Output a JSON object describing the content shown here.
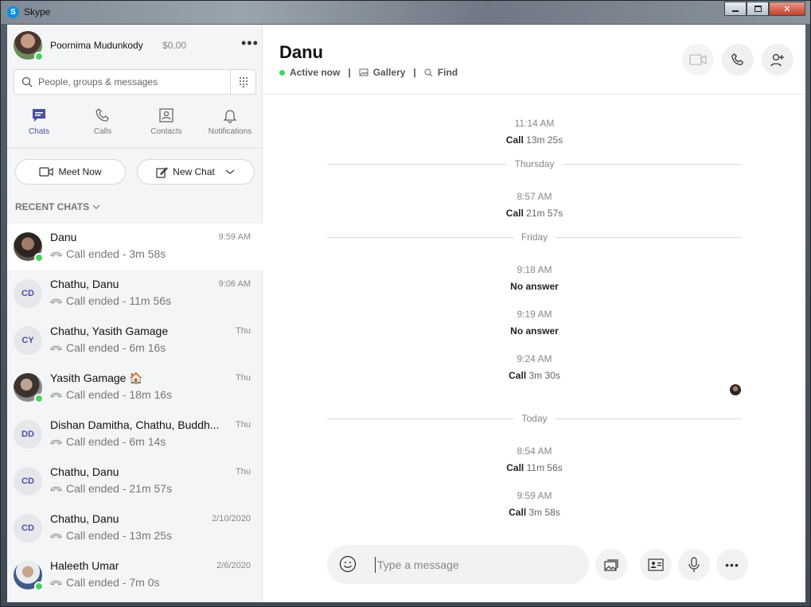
{
  "window": {
    "title": "Skype"
  },
  "profile": {
    "name": "Poornima Mudunkody",
    "credit": "$0.00"
  },
  "search": {
    "placeholder": "People, groups & messages"
  },
  "nav": [
    {
      "label": "Chats"
    },
    {
      "label": "Calls"
    },
    {
      "label": "Contacts"
    },
    {
      "label": "Notifications"
    }
  ],
  "actions": {
    "meet_now": "Meet Now",
    "new_chat": "New Chat"
  },
  "recent": {
    "title": "RECENT CHATS"
  },
  "chats": [
    {
      "name": "Danu",
      "time": "9:59 AM",
      "sub": "Call ended - 3m 58s",
      "initials": ""
    },
    {
      "name": "Chathu, Danu",
      "time": "9:06 AM",
      "sub": "Call ended - 11m 56s",
      "initials": "CD"
    },
    {
      "name": "Chathu, Yasith Gamage",
      "time": "Thu",
      "sub": "Call ended - 6m 16s",
      "initials": "CY"
    },
    {
      "name": "Yasith Gamage 🏠",
      "time": "Thu",
      "sub": "Call ended - 18m 16s",
      "initials": ""
    },
    {
      "name": "Dishan Damitha, Chathu, Buddh...",
      "time": "Thu",
      "sub": "Call ended - 6m 14s",
      "initials": "DD"
    },
    {
      "name": "Chathu, Danu",
      "time": "Thu",
      "sub": "Call ended - 21m 57s",
      "initials": "CD"
    },
    {
      "name": "Chathu, Danu",
      "time": "2/10/2020",
      "sub": "Call ended - 13m 25s",
      "initials": "CD"
    },
    {
      "name": "Haleeth Umar",
      "time": "2/6/2020",
      "sub": "Call ended - 7m 0s",
      "initials": ""
    }
  ],
  "conversation": {
    "name": "Danu",
    "status": "Active now",
    "gallery": "Gallery",
    "find": "Find",
    "separators": {
      "thursday": "Thursday",
      "friday": "Friday",
      "today": "Today"
    },
    "messages": [
      {
        "time": "11:14 AM",
        "label": "Call",
        "detail": "13m 25s"
      },
      {
        "time": "8:57 AM",
        "label": "Call",
        "detail": "21m 57s"
      },
      {
        "time": "9:18 AM",
        "label": "No answer",
        "detail": ""
      },
      {
        "time": "9:19 AM",
        "label": "No answer",
        "detail": ""
      },
      {
        "time": "9:24 AM",
        "label": "Call",
        "detail": "3m 30s"
      },
      {
        "time": "8:54 AM",
        "label": "Call",
        "detail": "11m 56s"
      },
      {
        "time": "9:59 AM",
        "label": "Call",
        "detail": "3m 58s"
      }
    ]
  },
  "composer": {
    "placeholder": "Type a message"
  },
  "colors": {
    "accent": "#4a4fa5",
    "presence": "#4bd25e",
    "skype_blue": "#0a8fe0"
  }
}
